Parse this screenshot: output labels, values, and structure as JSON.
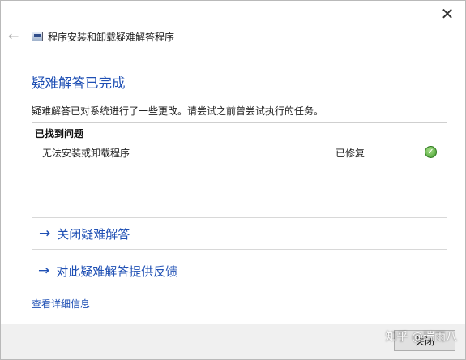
{
  "window": {
    "title": "程序安装和卸载疑难解答程序",
    "close_glyph": "✕",
    "back_glyph": "←"
  },
  "main": {
    "heading": "疑难解答已完成",
    "description": "疑难解答已对系统进行了一些更改。请尝试之前曾尝试执行的任务。",
    "problems": {
      "header": "已找到问题",
      "items": [
        {
          "name": "无法安装或卸载程序",
          "status": "已修复",
          "status_icon": "check-circle-icon"
        }
      ]
    },
    "actions": [
      {
        "label": "关闭疑难解答",
        "icon": "arrow-right-icon"
      },
      {
        "label": "对此疑难解答提供反馈",
        "icon": "arrow-right-icon"
      }
    ],
    "details_link": "查看详细信息"
  },
  "footer": {
    "close_button": "关闭"
  },
  "watermark": "知乎 @瑞雨八",
  "colors": {
    "accent": "#1e4fb4",
    "success": "#3f9a2a",
    "footer_bg": "#f0f0f0"
  }
}
